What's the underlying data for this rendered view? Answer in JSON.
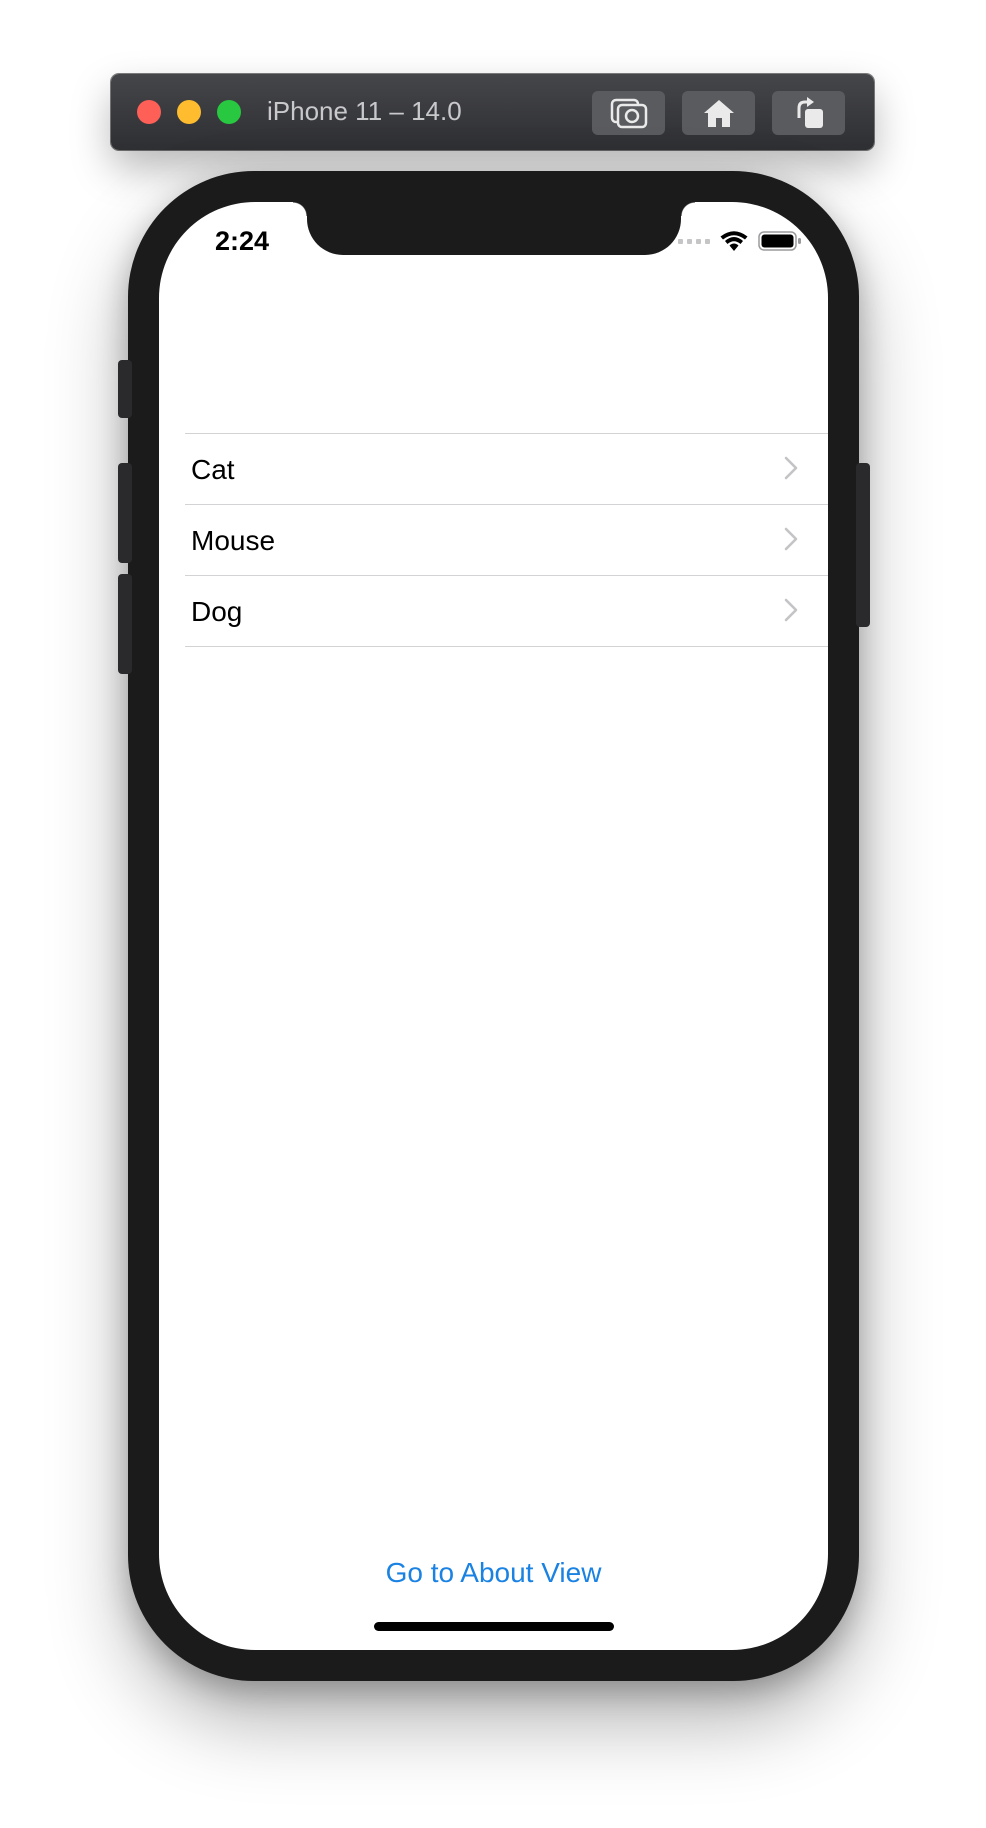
{
  "window": {
    "title": "iPhone 11 – 14.0",
    "toolbar_icons": [
      "screenshot-icon",
      "home-icon",
      "rotate-icon"
    ]
  },
  "status_bar": {
    "time": "2:24"
  },
  "list": {
    "items": [
      {
        "label": "Cat"
      },
      {
        "label": "Mouse"
      },
      {
        "label": "Dog"
      }
    ]
  },
  "footer": {
    "link_label": "Go to About View",
    "link_color": "#1a82e2"
  }
}
